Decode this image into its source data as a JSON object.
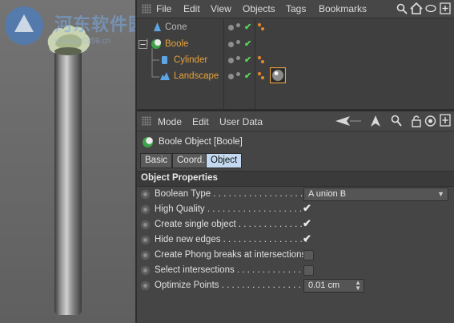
{
  "watermark": {
    "text": "河东软件园",
    "url": "www.pc0359.cn"
  },
  "object_manager": {
    "menu": [
      "File",
      "Edit",
      "View",
      "Objects",
      "Tags",
      "Bookmarks"
    ],
    "objects": [
      {
        "name": "Cone",
        "color": "#9a9a9a"
      },
      {
        "name": "Boole",
        "color": "#e8a33c"
      },
      {
        "name": "Cylinder",
        "color": "#e8a33c"
      },
      {
        "name": "Landscape",
        "color": "#e8a33c"
      }
    ]
  },
  "attribute_manager": {
    "menu": [
      "Mode",
      "Edit",
      "User Data"
    ],
    "object_title": "Boole Object [Boole]",
    "tabs": [
      {
        "label": "Basic",
        "active": false
      },
      {
        "label": "Coord.",
        "active": false
      },
      {
        "label": "Object",
        "active": true
      }
    ],
    "section_title": "Object Properties",
    "properties": [
      {
        "label": "Boolean Type . . . . . . . . . . . . . . . . . .",
        "type": "dropdown",
        "value": "A union B"
      },
      {
        "label": "High Quality . . . . . . . . . . . . . . . . . . .",
        "type": "checkbox",
        "checked": true
      },
      {
        "label": "Create single object . . . . . . . . . . . . .",
        "type": "checkbox",
        "checked": true
      },
      {
        "label": "Hide new edges . . . . . . . . . . . . . . . . .",
        "type": "checkbox",
        "checked": true
      },
      {
        "label": "Create Phong breaks at intersections",
        "type": "checkbox",
        "checked": false
      },
      {
        "label": "Select intersections . . . . . . . . . . . . . .",
        "type": "checkbox",
        "checked": false
      },
      {
        "label": "Optimize Points . . . . . . . . . . . . . . . . .",
        "type": "number",
        "value": "0.01 cm"
      }
    ]
  },
  "colors": {
    "accent_tab": "#c4d9f0",
    "check_green": "#58d558",
    "object_orange": "#e8a33c"
  }
}
